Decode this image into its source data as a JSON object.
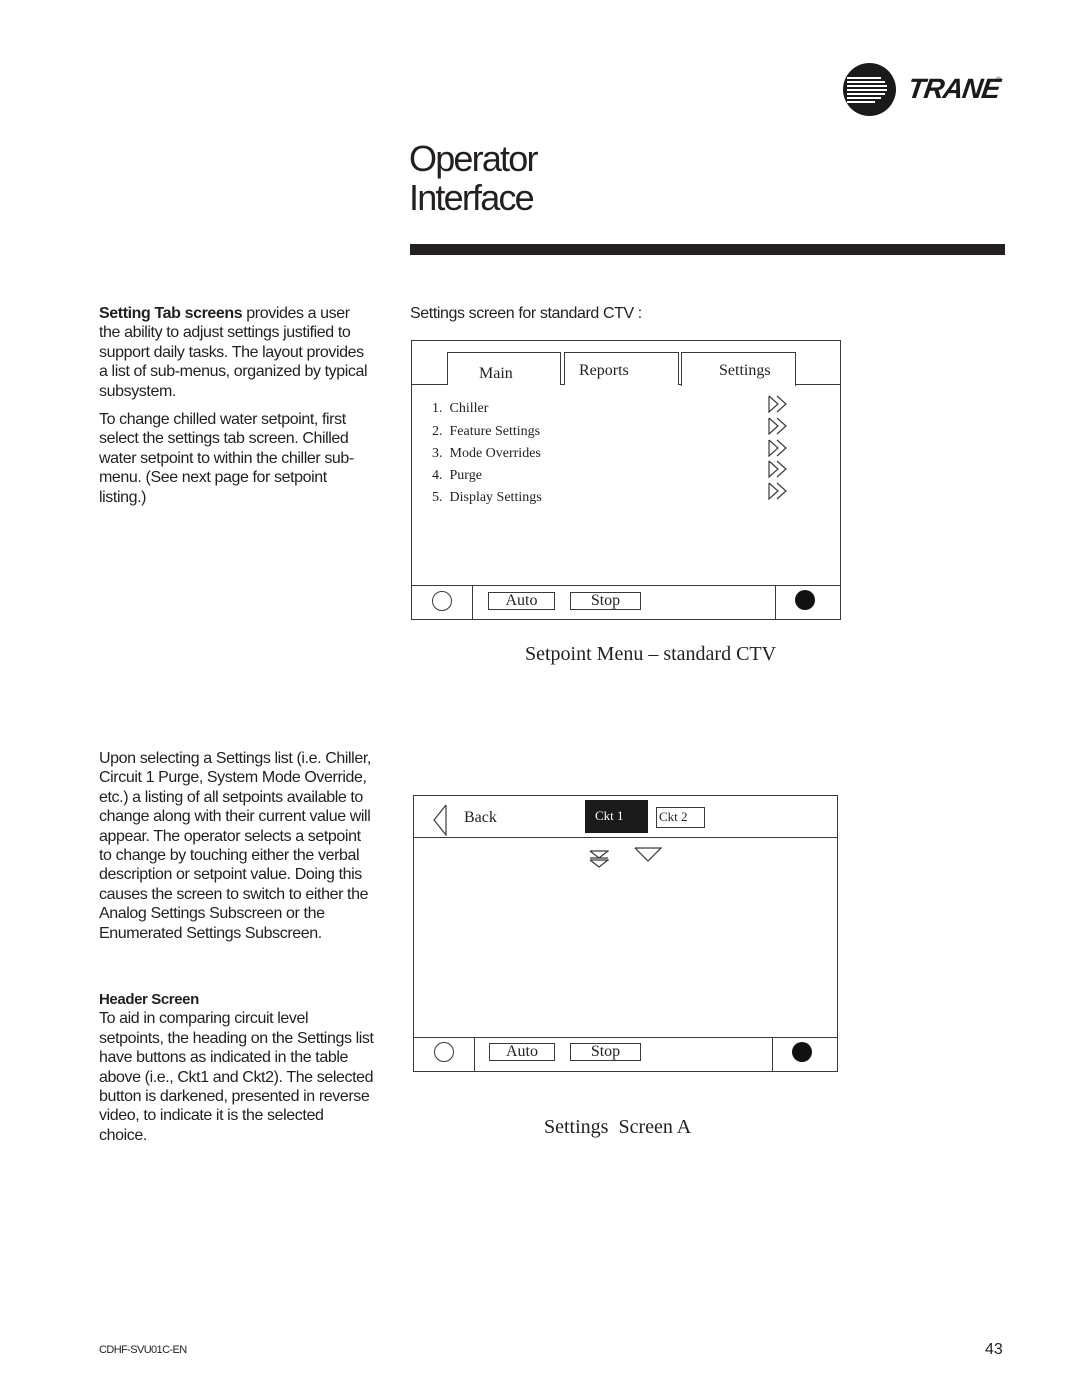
{
  "brand": {
    "name": "TRANE",
    "registered_mark": "®",
    "logo_icon": "trane-circle-logo-icon"
  },
  "header": {
    "title_line1": "Operator",
    "title_line2": "Interface"
  },
  "left_column": {
    "para1_bold": "Setting Tab screens",
    "para1_rest": " provides a user the ability to adjust settings justified to support daily tasks. The layout provides a list of sub-menus, organized by typical subsystem.",
    "para2": "To change chilled water setpoint, first select the settings tab screen. Chilled water setpoint to within the chiller sub-menu. (See next page for setpoint listing.)",
    "para3": "Upon selecting a Settings list (i.e. Chiller, Circuit 1 Purge, System Mode Override, etc.) a listing of all setpoints available to change along with their current value will appear. The operator selects a setpoint to change by touching either the verbal description or setpoint value. Doing this causes the screen to switch to either the Analog Settings Subscreen or the Enumerated Settings Subscreen.",
    "header_screen_heading": "Header Screen",
    "para4": "To aid in comparing circuit level setpoints, the heading on the Settings list have buttons as indicated in the table above (i.e., Ckt1 and Ckt2). The selected button is darkened, presented in reverse video, to indicate it is the selected choice."
  },
  "figure1": {
    "intro": "Settings screen for standard CTV :",
    "tabs": [
      {
        "label": "Main",
        "selected": false
      },
      {
        "label": "Reports",
        "selected": false
      },
      {
        "label": "Settings",
        "selected": true
      }
    ],
    "menu_items": [
      {
        "number": "1.",
        "label": "Chiller",
        "icon": "fast-forward-icon"
      },
      {
        "number": "2.",
        "label": "Feature Settings",
        "icon": "fast-forward-icon"
      },
      {
        "number": "3.",
        "label": "Mode Overrides",
        "icon": "fast-forward-icon"
      },
      {
        "number": "4.",
        "label": "Purge",
        "icon": "fast-forward-icon"
      },
      {
        "number": "5.",
        "label": "Display Settings",
        "icon": "fast-forward-icon"
      }
    ],
    "footer": {
      "auto_label": "Auto",
      "stop_label": "Stop",
      "left_indicator": "empty-circle-icon",
      "right_indicator": "filled-circle-icon"
    },
    "caption": "Setpoint Menu – standard CTV"
  },
  "figure2": {
    "back_label": "Back",
    "circuit_buttons": [
      {
        "label": "Ckt 1",
        "selected": true
      },
      {
        "label": "Ckt 2",
        "selected": false
      }
    ],
    "scroll_icons": [
      "page-down-icon",
      "scroll-down-icon"
    ],
    "footer": {
      "auto_label": "Auto",
      "stop_label": "Stop",
      "left_indicator": "empty-circle-icon",
      "right_indicator": "filled-circle-icon"
    },
    "caption": "Settings  Screen A"
  },
  "page_footer": {
    "doc_code": "CDHF-SVU01C-EN",
    "page_number": "43"
  }
}
